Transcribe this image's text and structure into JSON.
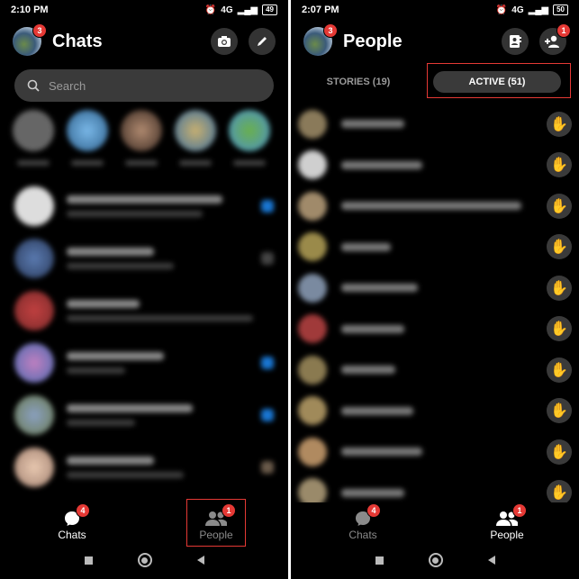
{
  "left": {
    "status": {
      "time": "2:10 PM",
      "battery": "49",
      "network": "4G"
    },
    "header": {
      "title": "Chats",
      "avatar_badge": "3"
    },
    "search": {
      "placeholder": "Search"
    },
    "nav": {
      "chats_label": "Chats",
      "chats_badge": "4",
      "people_label": "People",
      "people_badge": "1"
    }
  },
  "right": {
    "status": {
      "time": "2:07 PM",
      "battery": "50",
      "network": "4G"
    },
    "header": {
      "title": "People",
      "avatar_badge": "3",
      "add_badge": "1"
    },
    "tabs": {
      "stories": "STORIES (19)",
      "active": "ACTIVE (51)"
    },
    "nav": {
      "chats_label": "Chats",
      "chats_badge": "4",
      "people_label": "People",
      "people_badge": "1"
    }
  },
  "colors": {
    "accent": "#e53935",
    "background": "#000000",
    "surface": "#3a3a3a"
  },
  "icons": [
    "camera-icon",
    "pencil-icon",
    "search-icon",
    "chat-bubble-icon",
    "people-icon",
    "contacts-icon",
    "add-person-icon",
    "wave-icon"
  ]
}
